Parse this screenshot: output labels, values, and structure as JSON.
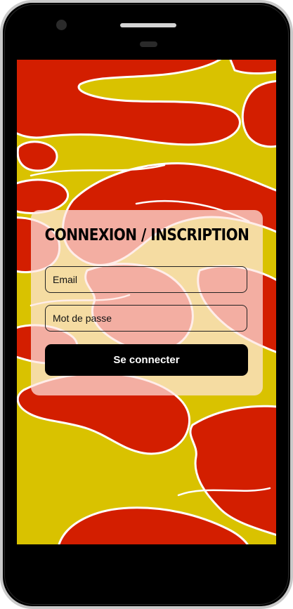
{
  "login": {
    "title": "CONNEXION / INSCRIPTION",
    "email_placeholder": "Email",
    "password_placeholder": "Mot de passe",
    "submit_label": "Se connecter"
  },
  "colors": {
    "background_yellow": "#d9c200",
    "flame_red": "#d31e00",
    "flame_outline": "#ffffff",
    "button_black": "#000000",
    "phone_frame": "#000000"
  },
  "icons": {
    "camera": "front-camera-icon",
    "speaker": "earpiece-speaker-icon"
  }
}
